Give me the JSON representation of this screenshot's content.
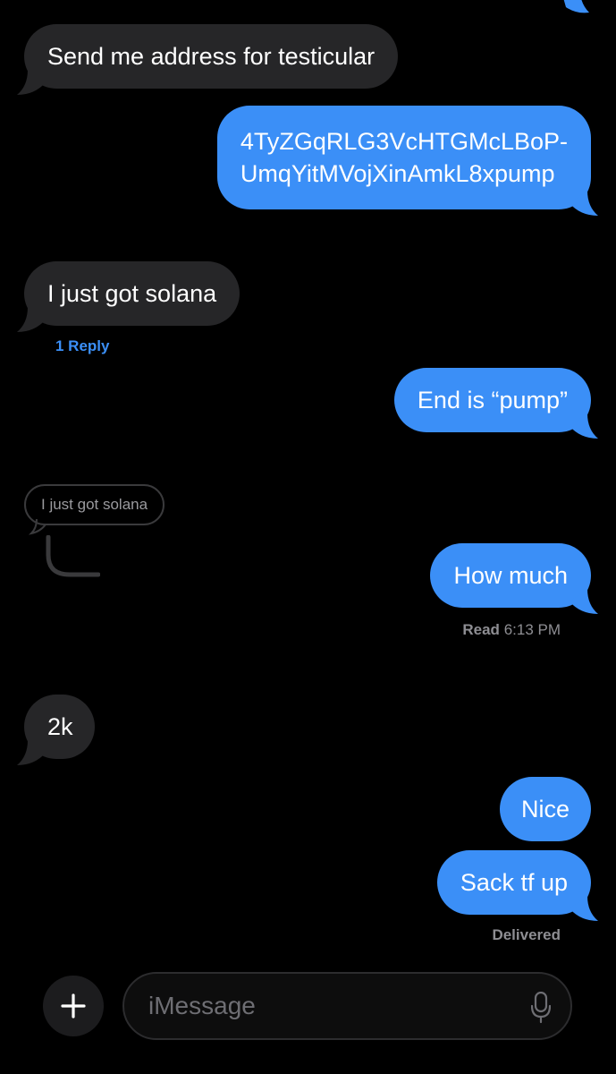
{
  "messages": {
    "m1": "Send me address for testicular",
    "m2_line1": "4TyZGqRLG3VcHTGMcLBoP-",
    "m2_line2": "UmqYitMVojXinAmkL8xpump",
    "m3": "I just got solana",
    "m3_replies": "1 Reply",
    "m4": "End is “pump”",
    "quoted": "I just got solana",
    "m5": "How much",
    "m5_read_label": "Read",
    "m5_read_time": "6:13 PM",
    "m6": "2k",
    "m7": "Nice",
    "m8": "Sack tf up",
    "m8_status": "Delivered"
  },
  "composer": {
    "placeholder": "iMessage"
  },
  "icons": {
    "add": "plus-icon",
    "mic": "microphone-icon"
  },
  "colors": {
    "incoming": "#262628",
    "outgoing": "#3b8ff7",
    "background": "#000000",
    "link": "#3b8ff7",
    "meta": "#8e8e93"
  }
}
